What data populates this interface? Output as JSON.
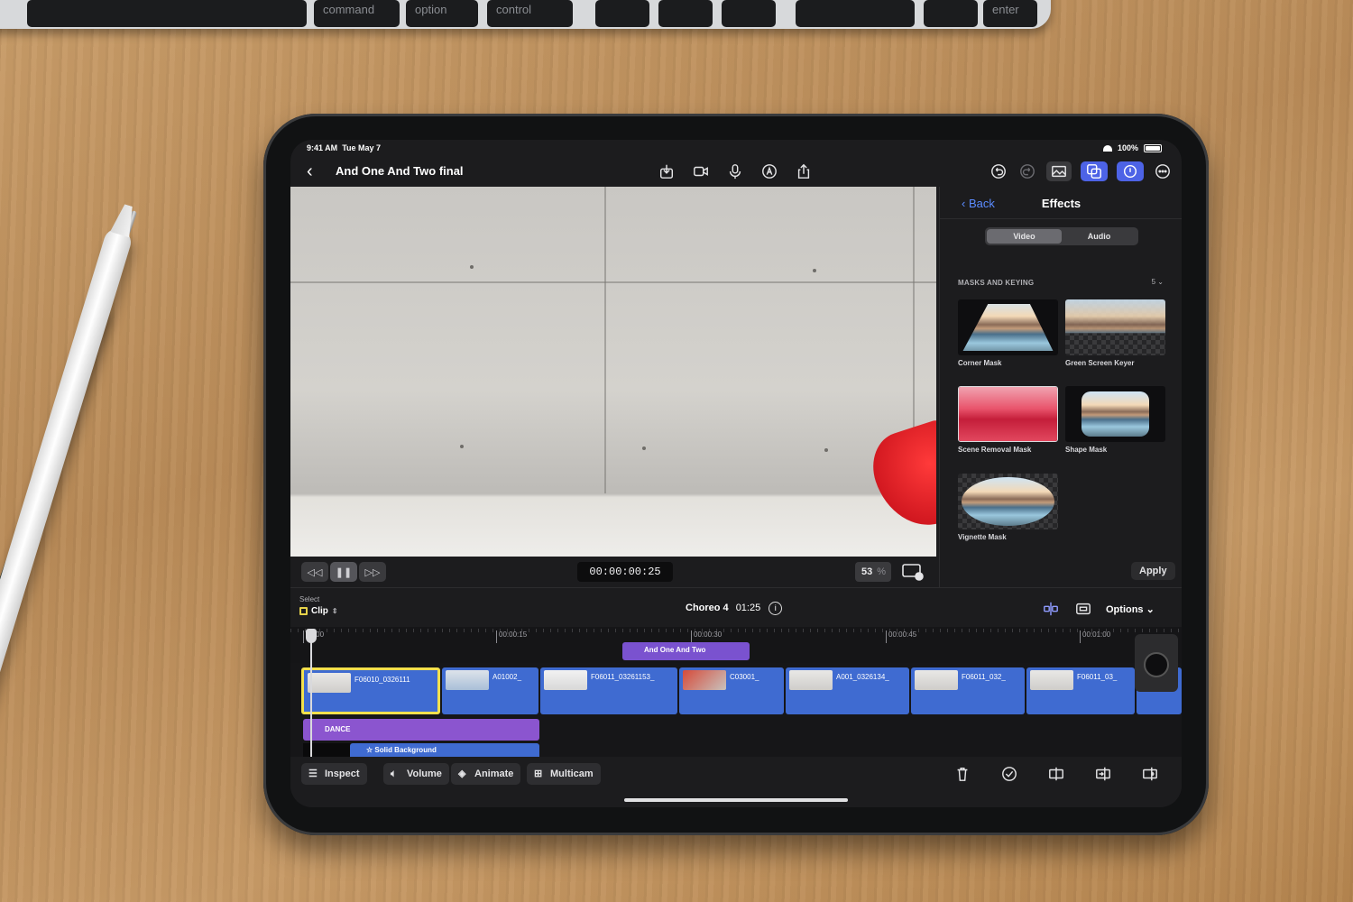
{
  "keyboard": {
    "keys": [
      {
        "label": "command"
      },
      {
        "label": "option"
      },
      {
        "label": "control"
      },
      {
        "label": ""
      },
      {
        "label": ""
      },
      {
        "label": ""
      },
      {
        "label": ""
      },
      {
        "label": ""
      },
      {
        "label": "enter"
      }
    ]
  },
  "status": {
    "time": "9:41 AM",
    "date": "Tue May 7",
    "battery": "100%"
  },
  "project": {
    "title": "And One And Two final"
  },
  "playback": {
    "timecode": "00:00:00:25",
    "zoom": "53",
    "zoom_unit": "%"
  },
  "effects": {
    "back_label": "Back",
    "title": "Effects",
    "tabs": [
      {
        "label": "Video",
        "selected": true
      },
      {
        "label": "Audio",
        "selected": false
      }
    ],
    "section": "MASKS AND KEYING",
    "count": "5",
    "items": [
      {
        "label": "Corner Mask"
      },
      {
        "label": "Green Screen Keyer"
      },
      {
        "label": "Scene Removal Mask"
      },
      {
        "label": "Shape Mask"
      },
      {
        "label": "Vignette Mask"
      }
    ],
    "apply_label": "Apply"
  },
  "timeline": {
    "select_label": "Select",
    "select_value": "Clip",
    "project_name": "Choreo 4",
    "duration": "01:25",
    "options_label": "Options",
    "ruler": [
      "00:00",
      "00:00:15",
      "00:00:30",
      "00:00:45",
      "00:01:00"
    ],
    "title_clip": "And One And Two",
    "clips": [
      {
        "label": "F06010_0326111"
      },
      {
        "label": "A01002_"
      },
      {
        "label": "F06011_03261153_"
      },
      {
        "label": "C03001_"
      },
      {
        "label": "A001_0326134_"
      },
      {
        "label": "F06011_032_"
      },
      {
        "label": "F06011_03_"
      }
    ],
    "music_track": "DANCE",
    "generator": "Solid Background"
  },
  "toolbar": {
    "inspect": "Inspect",
    "volume": "Volume",
    "animate": "Animate",
    "multicam": "Multicam"
  },
  "colors": {
    "accent": "#4d63e6",
    "clip_blue": "#3f6bd1",
    "title_purple": "#7a52cf",
    "selection": "#f3e04d"
  }
}
